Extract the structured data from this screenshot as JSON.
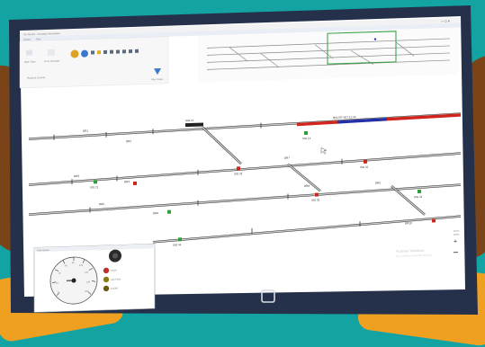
{
  "app": {
    "title": "RCI Monitor - Simulation Workstation",
    "menu": [
      "Control",
      "View",
      "Tools",
      "Help"
    ]
  },
  "ribbon": {
    "groups": [
      {
        "label": "Start / Stop"
      },
      {
        "label": "Go to Schedule"
      },
      {
        "label": "Playback Controls"
      }
    ],
    "filter_label": "Filter Trains"
  },
  "route_labels": [
    "DR1",
    "DR2",
    "DR3",
    "DR4",
    "DR5",
    "DR6",
    "DR7",
    "DR8",
    "DR9",
    "DR10"
  ],
  "signal_labels": [
    "SIG 12",
    "SIG 14",
    "SIG 21",
    "SIG 23",
    "SIG 31",
    "SIG 35",
    "SIG 41",
    "SIG 44"
  ],
  "occupied_route_label": "ROUTE SET 12-44",
  "gauge": {
    "title": "Train Speed",
    "ticks": [
      "0",
      "20",
      "40",
      "60",
      "80",
      "100",
      "120",
      "140",
      "160"
    ]
  },
  "indicators": [
    {
      "label": "STOP",
      "color": "#b8312a"
    },
    {
      "label": "CAUTION",
      "color": "#8a7a10"
    },
    {
      "label": "CLEAR",
      "color": "#6b5a12"
    }
  ],
  "zoom": {
    "label": "Zoom",
    "value": "100%"
  },
  "watermark": {
    "line1": "Activate Windows",
    "line2": "Go to Settings to activate Windows."
  },
  "colors": {
    "occupied_red": "#d0241c",
    "occupied_blue": "#2230a8",
    "bezel": "#25314a",
    "background": "#14a3a3"
  }
}
